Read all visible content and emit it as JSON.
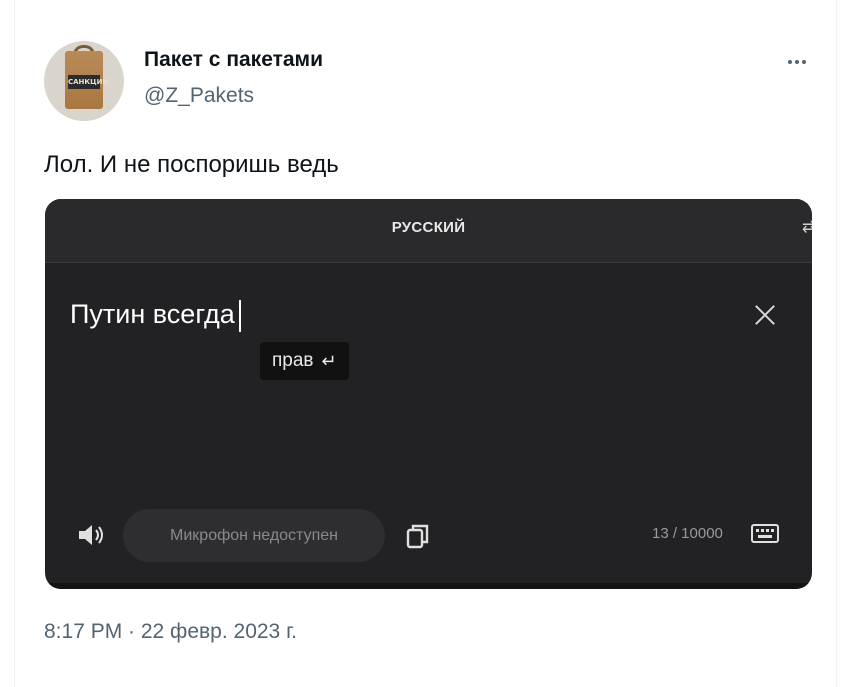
{
  "tweet": {
    "display_name": "Пакет с пакетами",
    "handle": "@Z_Pakets",
    "text": "Лол. И не поспоришь ведь",
    "timestamp": "8:17 PM · 22 февр. 2023 г."
  },
  "screenshot": {
    "language": "РУССКИЙ",
    "input_text": "Путин всегда",
    "suggestion": "прав",
    "mic_status": "Микрофон недоступен",
    "char_counter": "13 / 10000"
  },
  "icons": {
    "more": "more-icon",
    "close": "close-icon",
    "speaker": "speaker-icon",
    "copy": "copy-icon",
    "keyboard": "keyboard-icon",
    "enter": "enter-icon",
    "swap": "swap-icon"
  },
  "colors": {
    "media_background": "#222224",
    "secondary_text": "#536471",
    "primary_text": "#0f1419"
  }
}
